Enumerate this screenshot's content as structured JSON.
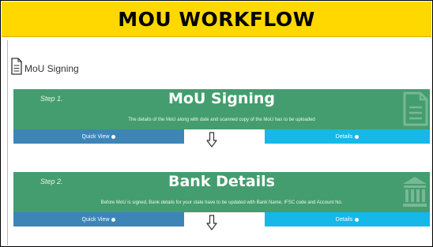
{
  "banner": {
    "title": "MOU WORKFLOW"
  },
  "page": {
    "title": "MoU Signing",
    "icon": "document-icon"
  },
  "steps": [
    {
      "label": "Step 1.",
      "title": "MoU Signing",
      "description": "The details of the MoU along with date and scanned copy of the MoU has to be uploaded",
      "icon": "document-icon",
      "quick_view": "Quick View",
      "details": "Details"
    },
    {
      "label": "Step 2.",
      "title": "Bank Details",
      "description": "Before MoU is signed, Bank details for your state have to be updated with Bank Name, IFSC code and Account No.",
      "icon": "bank-icon",
      "quick_view": "Quick View",
      "details": "Details"
    }
  ],
  "colors": {
    "banner": "#ffd800",
    "step_card": "#449d6e",
    "quick_view_button": "#3c85b6",
    "details_button": "#16b8e8"
  }
}
